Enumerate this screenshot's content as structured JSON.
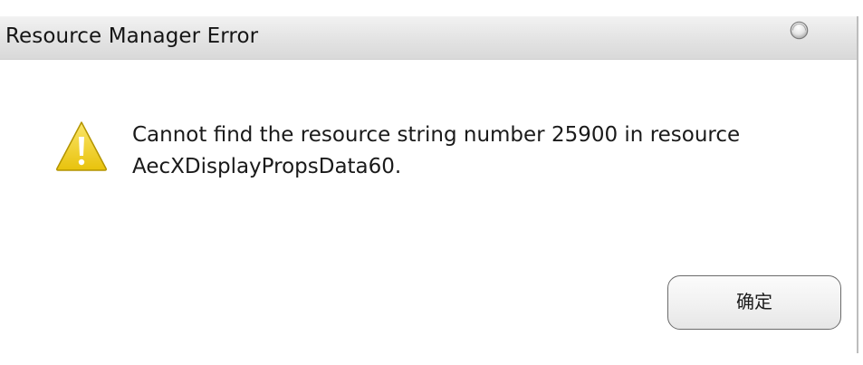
{
  "dialog": {
    "title": "Resource Manager Error",
    "title_icon": "window-orb-icon",
    "message_icon": "warning-icon",
    "message_lines": [
      "Cannot find the resource string number 25900 in resource",
      "AecXDisplayPropsData60."
    ],
    "ok_label": "确定"
  },
  "colors": {
    "warning_fill": "#f2d21a",
    "warning_outline": "#b39400",
    "button_border": "#6b6b6b"
  }
}
